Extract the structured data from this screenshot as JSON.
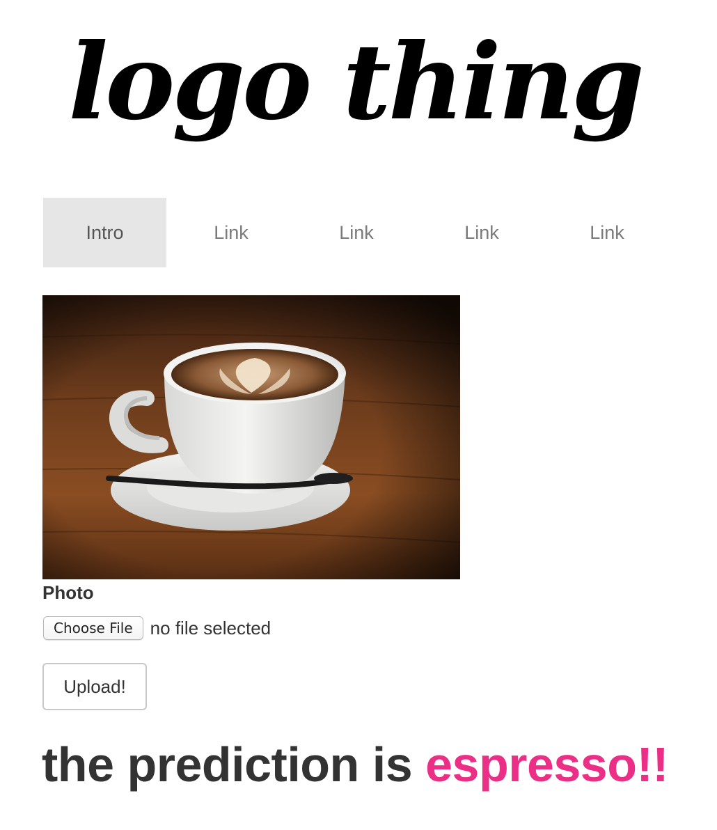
{
  "logo": {
    "text": "logo thing"
  },
  "nav": {
    "items": [
      {
        "label": "Intro",
        "active": true
      },
      {
        "label": "Link",
        "active": false
      },
      {
        "label": "Link",
        "active": false
      },
      {
        "label": "Link",
        "active": false
      },
      {
        "label": "Link",
        "active": false
      }
    ]
  },
  "photo": {
    "label": "Photo",
    "subject": "latte-art-coffee-cup"
  },
  "file_input": {
    "button_label": "Choose File",
    "status": "no file selected"
  },
  "upload": {
    "label": "Upload!"
  },
  "prediction": {
    "prefix": "the prediction is ",
    "value": "espresso!!",
    "value_color": "#ec2f86"
  }
}
